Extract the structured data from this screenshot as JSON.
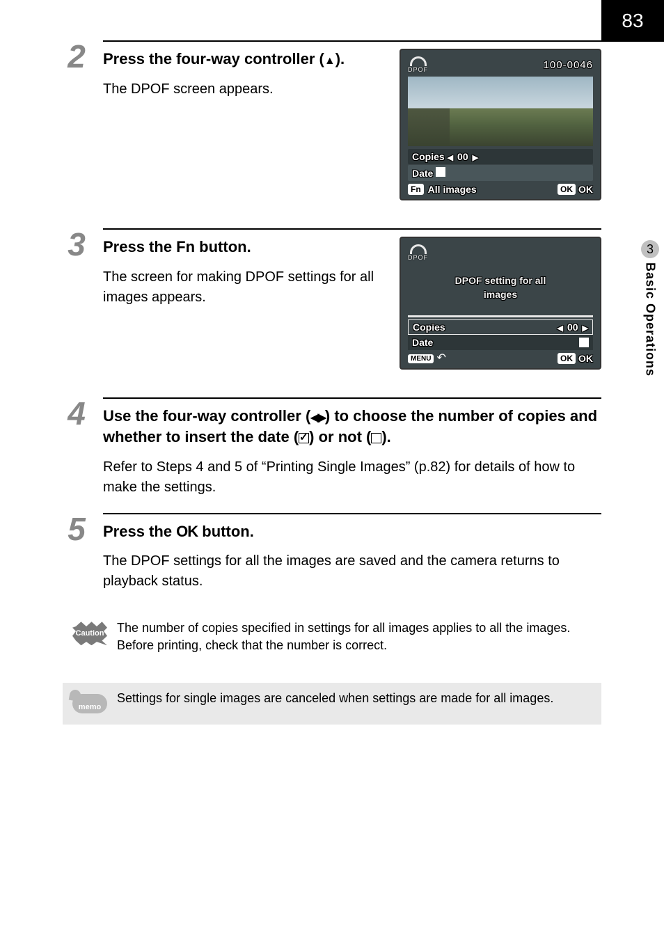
{
  "page": {
    "number": "83"
  },
  "side_tab": {
    "chapter_number": "3",
    "chapter_title": "Basic Operations"
  },
  "step2": {
    "number": "2",
    "title_prefix": "Press the four-way controller (",
    "title_suffix": ").",
    "desc": "The DPOF screen appears."
  },
  "step3": {
    "number": "3",
    "title_prefix": "Press the ",
    "title_fn": "Fn",
    "title_suffix": " button.",
    "desc": "The screen for making DPOF settings for all images appears."
  },
  "step4": {
    "number": "4",
    "title_prefix": "Use the four-way controller (",
    "title_mid": ") to choose the number of copies and whether to insert the date (",
    "title_mid2": ") or not (",
    "title_suffix": ").",
    "desc": "Refer to Steps 4 and 5 of “Printing Single Images” (p.82) for details of how to make the settings."
  },
  "step5": {
    "number": "5",
    "title_prefix": "Press the ",
    "title_ok": "OK",
    "title_suffix": " button.",
    "desc": "The DPOF settings for all the images are saved and the camera returns to playback status."
  },
  "caution": {
    "label": "Caution",
    "text": "The number of copies specified in settings for all images applies to all the images. Before printing, check that the number is correct."
  },
  "memo": {
    "label": "memo",
    "text": "Settings for single images are canceled when settings are made for all images."
  },
  "lcd1": {
    "dpof_tiny": "DPOF",
    "file_code": "100-0046",
    "copies_label": "Copies",
    "copies_value": "00",
    "date_label": "Date",
    "fn_badge": "Fn",
    "all_images": "All images",
    "ok_badge": "OK",
    "ok_label": "OK"
  },
  "lcd2": {
    "dpof_tiny": "DPOF",
    "heading_line1": "DPOF setting for all",
    "heading_line2": "images",
    "copies_label": "Copies",
    "copies_value": "00",
    "date_label": "Date",
    "menu_badge": "MENU",
    "ok_badge": "OK",
    "ok_label": "OK"
  }
}
